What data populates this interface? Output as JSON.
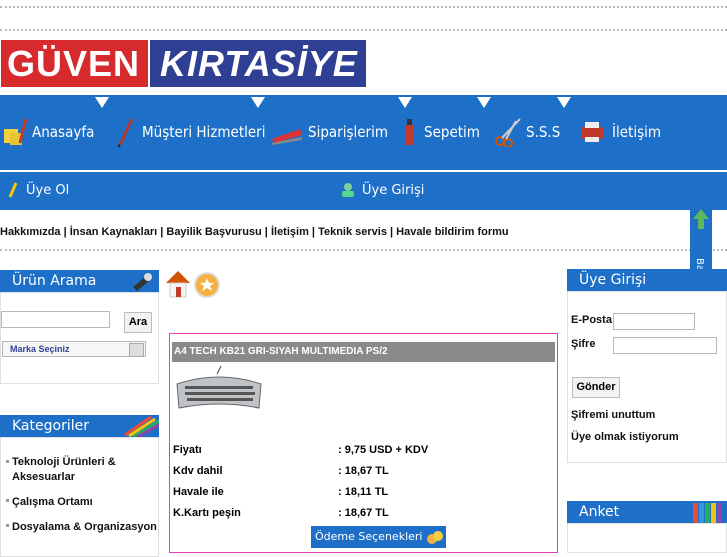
{
  "logo": {
    "part1": "GÜVEN",
    "part2": "KIRTASİYE"
  },
  "nav": [
    {
      "label": "Anasayfa",
      "icon": "notes-icon"
    },
    {
      "label": "Müşteri Hizmetleri",
      "icon": "pen-icon"
    },
    {
      "label": "Siparişlerim",
      "icon": "stapler-icon"
    },
    {
      "label": "Sepetim",
      "icon": "marker-icon"
    },
    {
      "label": "S.S.S",
      "icon": "scissors-icon"
    },
    {
      "label": "İletişim",
      "icon": "printer-icon"
    }
  ],
  "subnav": {
    "register": "Üye Ol",
    "login": "Üye Girişi"
  },
  "links": [
    "Hakkımızda",
    "İnsan Kaynakları",
    "Bayilik Başvurusu",
    "İletişim",
    "Teknik servis",
    "Havale bildirim formu"
  ],
  "search": {
    "title": "Ürün Arama",
    "button": "Ara",
    "brand_select": "Marka Seçiniz"
  },
  "categories": {
    "title": "Kategoriler",
    "items": [
      "Teknoloji Ürünleri & Aksesuarlar",
      "Çalışma Ortamı",
      "Dosyalama & Organizasyon"
    ]
  },
  "product": {
    "title": "A4 TECH KB21 GRI-SIYAH MULTIMEDIA PS/2",
    "prices": [
      {
        "label": "Fiyatı",
        "value": ": 9,75 USD + KDV"
      },
      {
        "label": "Kdv dahil",
        "value": ": 18,67 TL"
      },
      {
        "label": "Havale ile",
        "value": ": 18,11 TL"
      },
      {
        "label": "K.Kartı peşin",
        "value": ": 18,67 TL"
      }
    ],
    "payment_button": "Ödeme Seçenekleri"
  },
  "member": {
    "title": "Üye Girişi",
    "email_label": "E-Posta",
    "password_label": "Şifre",
    "submit": "Gönder",
    "forgot": "Şifremi unuttum",
    "register": "Üye olmak istiyorum"
  },
  "poll": {
    "title": "Anket"
  },
  "back_to_top": "Başa Dön",
  "colors": {
    "brand_blue": "#1e6fc7",
    "logo_red": "#d72a2c",
    "logo_navy": "#2f3f93",
    "product_border": "#e23fb1"
  }
}
